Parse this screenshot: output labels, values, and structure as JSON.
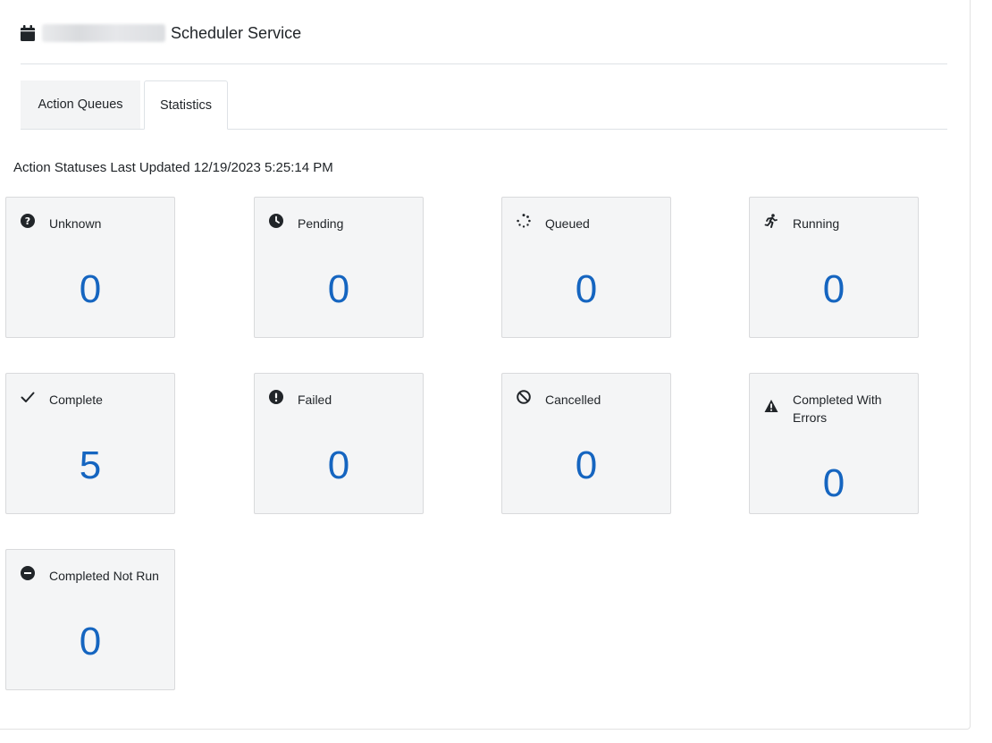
{
  "header": {
    "title": "Scheduler Service",
    "icon": "calendar-icon"
  },
  "tabs": [
    {
      "label": "Action Queues",
      "active": false
    },
    {
      "label": "Statistics",
      "active": true
    }
  ],
  "status": {
    "last_updated_label": "Action Statuses Last Updated 12/19/2023 5:25:14 PM"
  },
  "colors": {
    "value_blue": "#1565c0",
    "card_bg": "#f4f5f6",
    "tab_inactive_bg": "#f3f4f5"
  },
  "cards": [
    {
      "label": "Unknown",
      "value": "0",
      "icon": "question-circle-icon"
    },
    {
      "label": "Pending",
      "value": "0",
      "icon": "clock-icon"
    },
    {
      "label": "Queued",
      "value": "0",
      "icon": "spinner-icon"
    },
    {
      "label": "Running",
      "value": "0",
      "icon": "running-person-icon"
    },
    {
      "label": "Complete",
      "value": "5",
      "icon": "checkmark-icon"
    },
    {
      "label": "Failed",
      "value": "0",
      "icon": "exclamation-circle-icon"
    },
    {
      "label": "Cancelled",
      "value": "0",
      "icon": "ban-icon"
    },
    {
      "label": "Completed With Errors",
      "value": "0",
      "icon": "warning-triangle-icon"
    },
    {
      "label": "Completed Not Run",
      "value": "0",
      "icon": "minus-circle-icon"
    }
  ]
}
